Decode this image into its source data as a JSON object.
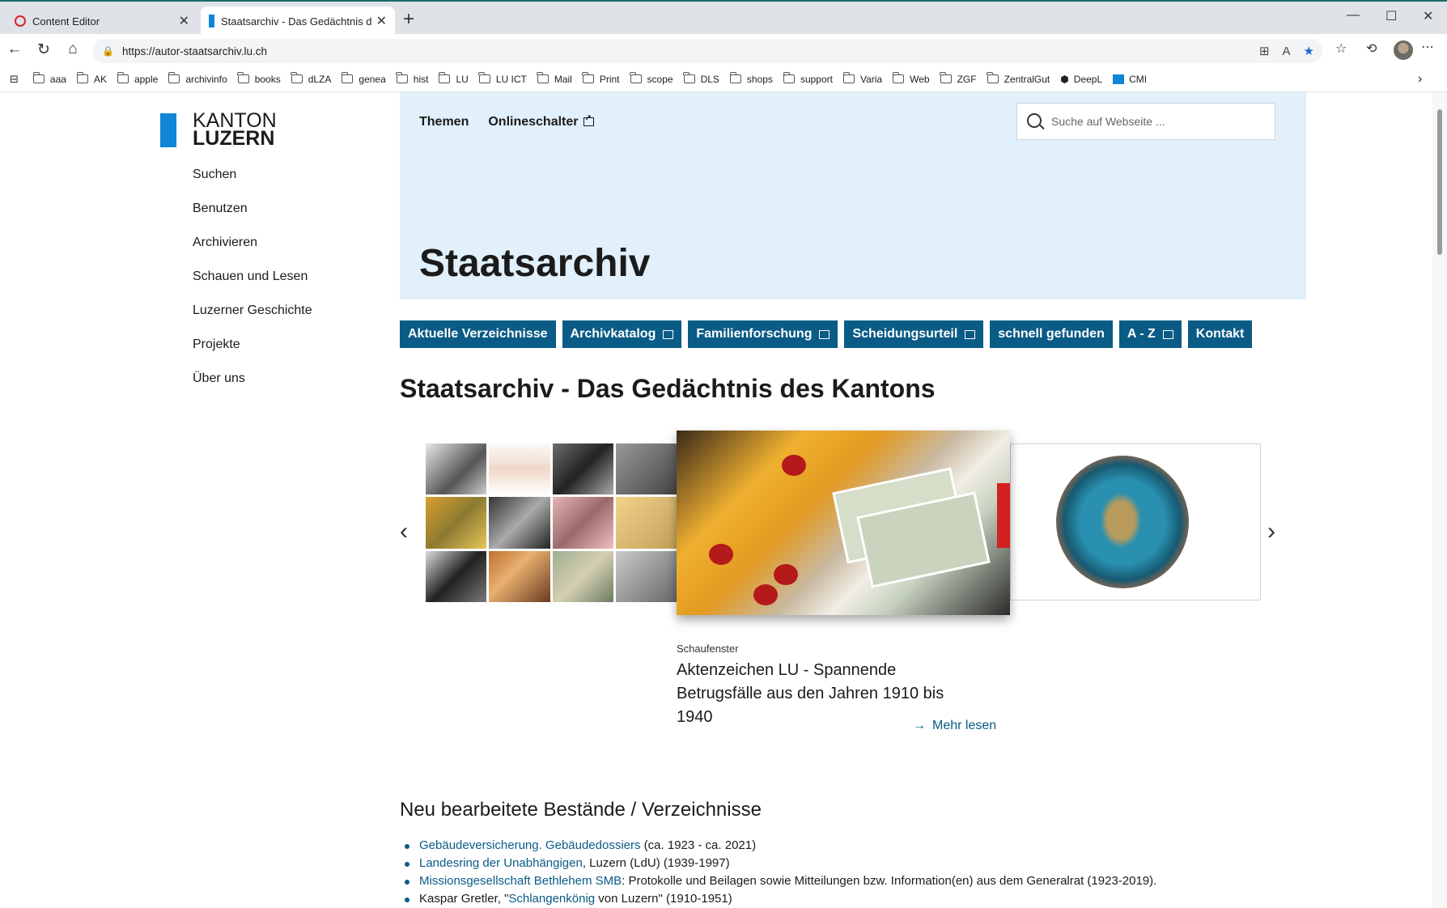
{
  "browser": {
    "tabs": [
      {
        "title": "Content Editor"
      },
      {
        "title": "Staatsarchiv - Das Gedächtnis des"
      }
    ],
    "url": "https://autor-staatsarchiv.lu.ch",
    "bookmarks": [
      "aaa",
      "AK",
      "apple",
      "archivinfo",
      "books",
      "dLZA",
      "genea",
      "hist",
      "LU",
      "LU ICT",
      "Mail",
      "Print",
      "scope",
      "DLS",
      "shops",
      "support",
      "Varia",
      "Web",
      "ZGF",
      "ZentralGut",
      "DeepL",
      "CMI"
    ]
  },
  "site": {
    "logo": {
      "line1": "KANTON",
      "line2": "LUZERN"
    },
    "sidenav": [
      "Suchen",
      "Benutzen",
      "Archivieren",
      "Schauen und Lesen",
      "Luzerner Geschichte",
      "Projekte",
      "Über uns"
    ],
    "topmenu": {
      "themen": "Themen",
      "onlineschalter": "Onlineschalter"
    },
    "search_placeholder": "Suche auf Webseite ...",
    "hero_title": "Staatsarchiv",
    "quicklinks": [
      {
        "label": "Aktuelle Verzeichnisse",
        "external": false
      },
      {
        "label": "Archivkatalog",
        "external": true
      },
      {
        "label": "Familienforschung",
        "external": true
      },
      {
        "label": "Scheidungsurteil",
        "external": true
      },
      {
        "label": "schnell gefunden",
        "external": false
      },
      {
        "label": "A - Z",
        "external": true
      },
      {
        "label": "Kontakt",
        "external": false
      }
    ],
    "page_title": "Staatsarchiv - Das Gedächtnis des Kantons",
    "carousel": {
      "caption": "Schaufenster",
      "title": "Aktenzeichen LU - Spannende Betrugsfälle aus den Jahren 1910 bis 1940",
      "more": "Mehr lesen"
    },
    "section_title": "Neu bearbeitete Bestände / Verzeichnisse",
    "list": {
      "i1_link": "Gebäudeversicherung. Gebäudedossiers",
      "i1_text": " (ca. 1923 - ca. 2021)",
      "i2_link": "Landesring der Unabhängigen",
      "i2_text": ", Luzern (LdU) (1939-1997)",
      "i3_link": "Missionsgesellschaft Bethlehem SMB",
      "i3_text": ": Protokolle und Beilagen sowie Mitteilungen bzw. Information(en) aus dem Generalrat (1923-2019).",
      "i4_pre": "Kaspar Gretler, \"",
      "i4_link": "Schlangenkönig",
      "i4_text": " von Luzern\" (1910-1951)"
    }
  }
}
